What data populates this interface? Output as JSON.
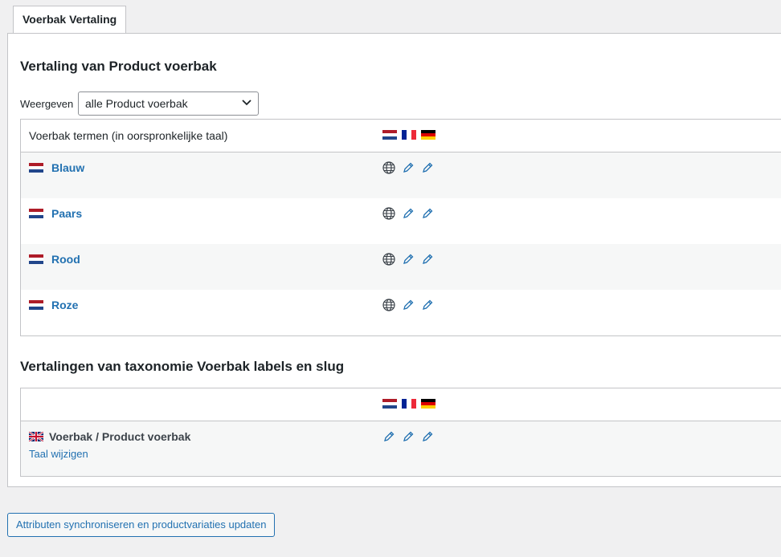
{
  "tab": {
    "label": "Voerbak Vertaling"
  },
  "section1": {
    "title": "Vertaling van Product voerbak",
    "filter_label": "Weergeven",
    "filter_value": "alle Product voerbak",
    "column_header": "Voerbak termen (in oorspronkelijke taal)",
    "terms": [
      {
        "name": "Blauw"
      },
      {
        "name": "Paars"
      },
      {
        "name": "Rood"
      },
      {
        "name": "Roze"
      }
    ]
  },
  "section2": {
    "title": "Vertalingen van taxonomie Voerbak labels en slug",
    "row_name": "Voerbak / Product voerbak",
    "change_language": "Taal wijzigen"
  },
  "sync_button": "Attributen synchroniseren en productvariaties updaten",
  "colors": {
    "link": "#2271b1",
    "border": "#c3c4c7",
    "background": "#f0f0f1"
  }
}
